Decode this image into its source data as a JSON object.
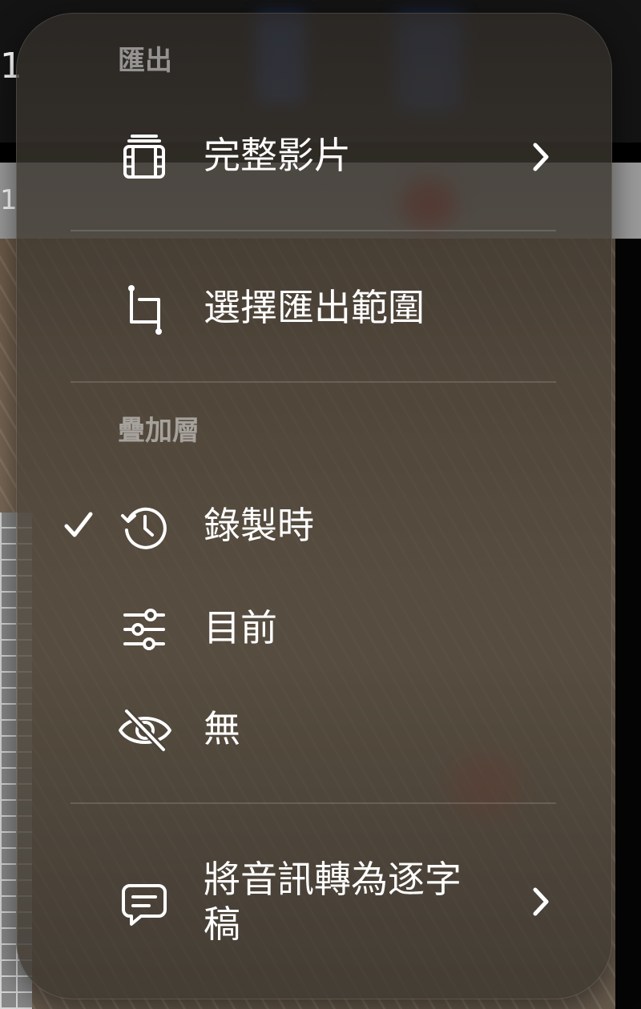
{
  "background": {
    "topbar_text": "1",
    "strip_text": "1"
  },
  "menu": {
    "export_header": "匯出",
    "full_video_label": "完整影片",
    "select_range_label": "選擇匯出範圍",
    "overlay_header": "疊加層",
    "overlay_options": [
      {
        "label": "錄製時",
        "icon": "history-icon",
        "selected": true
      },
      {
        "label": "目前",
        "icon": "sliders-icon",
        "selected": false
      },
      {
        "label": "無",
        "icon": "eye-slash-icon",
        "selected": false
      }
    ],
    "transcribe_label_line1": "將音訊轉為逐字",
    "transcribe_label_line2": "稿"
  },
  "colors": {
    "menu_text": "#ffffff",
    "header_text": "#a39e98",
    "divider": "#5b534a"
  }
}
